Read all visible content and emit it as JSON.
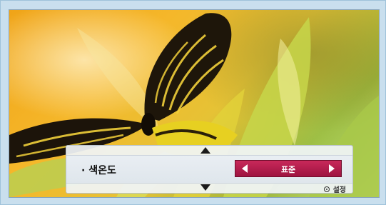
{
  "osd": {
    "item_label": "· 색온도",
    "value": "표준",
    "hint_label": "설정"
  },
  "icons": {
    "up": "triangle-up-icon",
    "down": "triangle-down-icon",
    "left": "triangle-left-icon",
    "right": "triangle-right-icon",
    "ok": "ok-button-icon"
  },
  "colors": {
    "selector": "#b51e4e",
    "panel": "#eef2f6"
  }
}
